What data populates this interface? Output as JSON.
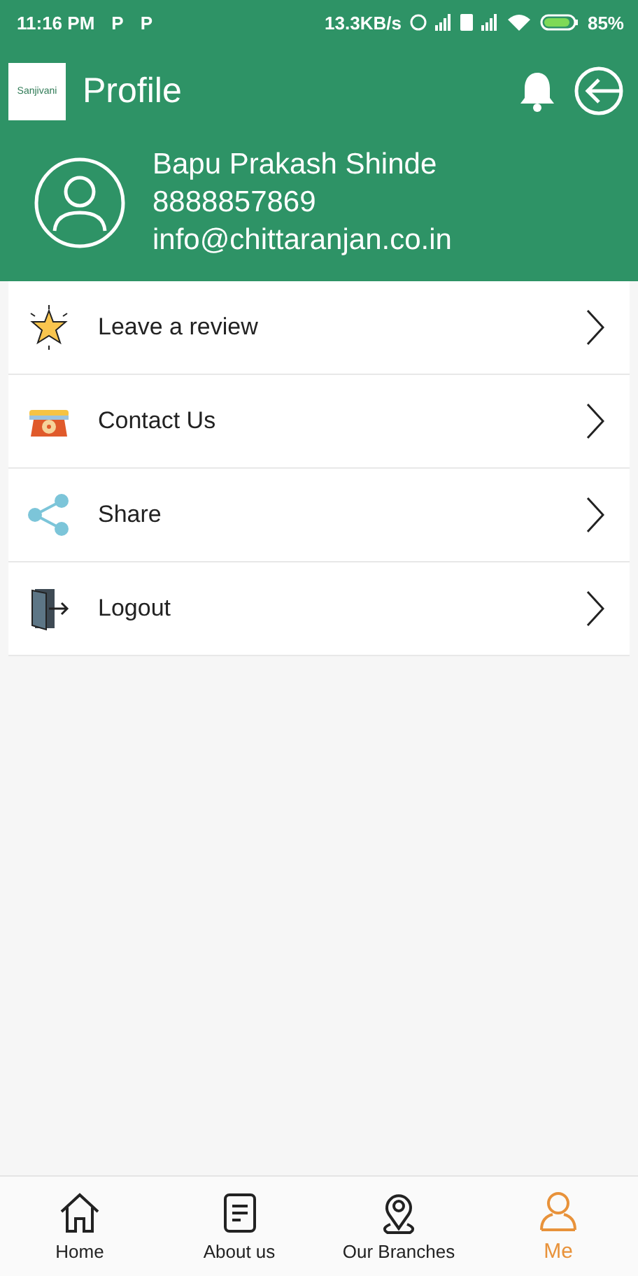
{
  "status_bar": {
    "time": "11:16 PM",
    "notifications": [
      "P",
      "P"
    ],
    "speed": "13.3KB/s",
    "battery": "85%"
  },
  "header": {
    "logo": "Sanjivani",
    "title": "Profile"
  },
  "profile": {
    "name": "Bapu Prakash Shinde",
    "phone": "8888857869",
    "email": "info@chittaranjan.co.in"
  },
  "menu": [
    {
      "kind": "review",
      "label": "Leave a review"
    },
    {
      "kind": "contact",
      "label": "Contact Us"
    },
    {
      "kind": "share",
      "label": "Share"
    },
    {
      "kind": "logout",
      "label": "Logout"
    }
  ],
  "bottom_nav": [
    {
      "kind": "home",
      "label": "Home",
      "selected": false
    },
    {
      "kind": "about",
      "label": "About us",
      "selected": false
    },
    {
      "kind": "branches",
      "label": "Our Branches",
      "selected": false
    },
    {
      "kind": "me",
      "label": "Me",
      "selected": true
    }
  ]
}
